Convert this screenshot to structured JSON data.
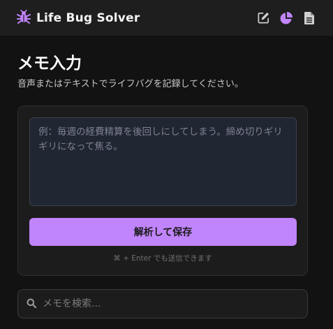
{
  "header": {
    "app_title": "Life Bug Solver",
    "logo_icon": "bug-icon",
    "actions": [
      {
        "icon": "edit-icon"
      },
      {
        "icon": "pie-chart-icon"
      },
      {
        "icon": "document-icon"
      }
    ]
  },
  "main": {
    "title": "メモ入力",
    "subtitle": "音声またはテキストでライフバグを記録してください。"
  },
  "memo": {
    "value": "",
    "placeholder": "例：毎週の経費精算を後回しにしてしまう。締め切りギリギリになって焦る。",
    "submit_label": "解析して保存",
    "shortcut_hint": "⌘ + Enter でも送信できます"
  },
  "search": {
    "value": "",
    "placeholder": "メモを検索..."
  },
  "colors": {
    "accent": "#c084fc",
    "background": "#121212",
    "header_bg": "#1e1e1e"
  }
}
